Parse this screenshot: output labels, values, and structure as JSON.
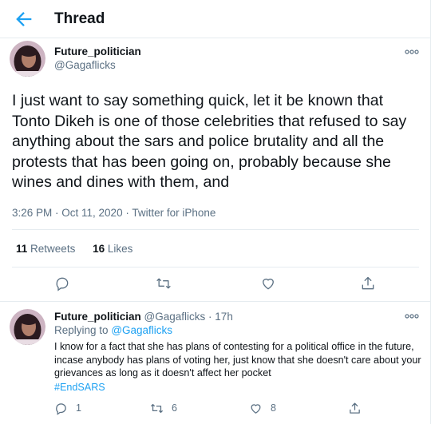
{
  "header": {
    "title": "Thread",
    "back_icon": "arrow-left-icon"
  },
  "accent_color": "#1da1f2",
  "main_tweet": {
    "name": "Future_politician",
    "handle": "@Gagaflicks",
    "text": "I just want to say something quick, let it be known that Tonto Dikeh is one of those celebrities that refused to say anything about the sars and police brutality and all the protests that has been going on, probably because she wines and dines with them, and",
    "meta": "3:26 PM · Oct 11, 2020 · Twitter for iPhone",
    "retweets_count": "11",
    "retweets_label": "Retweets",
    "likes_count": "16",
    "likes_label": "Likes"
  },
  "reply_tweet": {
    "name": "Future_politician",
    "handle": "@Gagaflicks",
    "time": "17h",
    "replying_to_label": "Replying to",
    "replying_to_handle": "@Gagaflicks",
    "text": "I know for a fact that she has plans of contesting for a political office in the future, incase anybody has plans of voting her, just know that she doesn't care about your grievances as long as it doesn't affect her pocket",
    "hashtag": "#EndSARS",
    "reply_count": "1",
    "retweet_count": "6",
    "like_count": "8"
  }
}
